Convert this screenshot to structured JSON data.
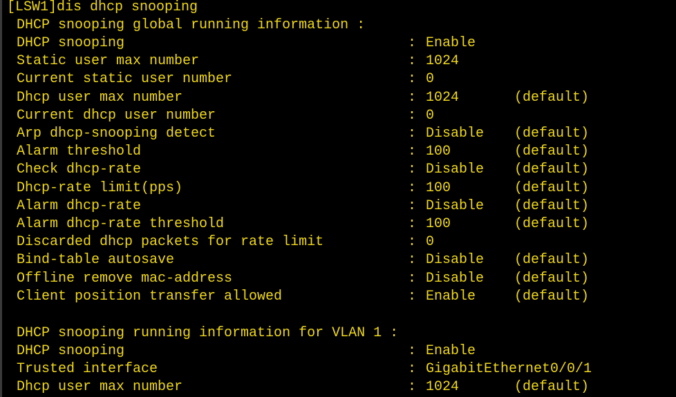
{
  "terminal": {
    "text_color": "#f0d81a",
    "background": "#000000",
    "command_line": "[LSW1]dis dhcp snooping",
    "global_header": "DHCP snooping global running information :",
    "global_rows": [
      {
        "label": "DHCP snooping",
        "value": "Enable",
        "note": ""
      },
      {
        "label": "Static user max number",
        "value": "1024",
        "note": ""
      },
      {
        "label": "Current static user number",
        "value": "0",
        "note": ""
      },
      {
        "label": "Dhcp user max number",
        "value": "1024",
        "note": "(default)"
      },
      {
        "label": "Current dhcp user number",
        "value": "0",
        "note": ""
      },
      {
        "label": "Arp dhcp-snooping detect",
        "value": "Disable",
        "note": "(default)"
      },
      {
        "label": "Alarm threshold",
        "value": "100",
        "note": "(default)"
      },
      {
        "label": "Check dhcp-rate",
        "value": "Disable",
        "note": "(default)"
      },
      {
        "label": "Dhcp-rate limit(pps)",
        "value": "100",
        "note": "(default)"
      },
      {
        "label": "Alarm dhcp-rate",
        "value": "Disable",
        "note": "(default)"
      },
      {
        "label": "Alarm dhcp-rate threshold",
        "value": "100",
        "note": "(default)"
      },
      {
        "label": "Discarded dhcp packets for rate limit",
        "value": "0",
        "note": ""
      },
      {
        "label": "Bind-table autosave",
        "value": "Disable",
        "note": "(default)"
      },
      {
        "label": "Offline remove mac-address",
        "value": "Disable",
        "note": "(default)"
      },
      {
        "label": "Client position transfer allowed",
        "value": "Enable",
        "note": "(default)"
      }
    ],
    "vlan_header": "DHCP snooping running information for VLAN 1 :",
    "vlan_rows": [
      {
        "label": "DHCP snooping",
        "value": "Enable",
        "note": ""
      },
      {
        "label": "Trusted interface",
        "value": "GigabitEthernet0/0/1",
        "note": ""
      },
      {
        "label": "Dhcp user max number",
        "value": "1024",
        "note": "(default)"
      }
    ]
  }
}
